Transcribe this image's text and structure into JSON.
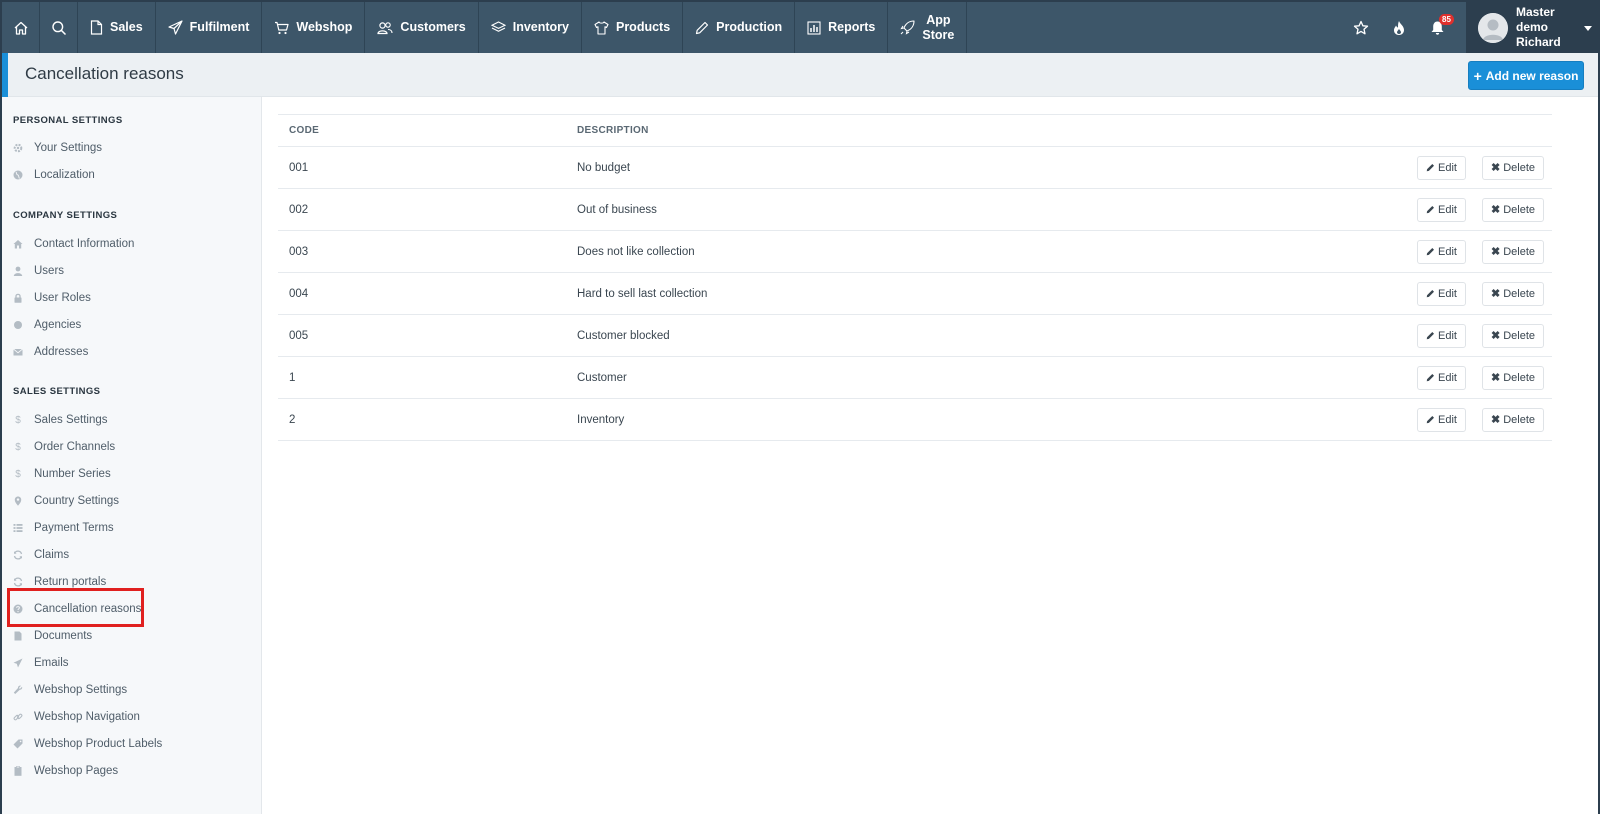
{
  "nav": {
    "items": [
      {
        "label": "Sales",
        "icon": "file-icon"
      },
      {
        "label": "Fulfilment",
        "icon": "paper-plane-icon"
      },
      {
        "label": "Webshop",
        "icon": "cart-icon"
      },
      {
        "label": "Customers",
        "icon": "users-icon"
      },
      {
        "label": "Inventory",
        "icon": "stack-icon"
      },
      {
        "label": "Products",
        "icon": "tshirt-icon"
      },
      {
        "label": "Production",
        "icon": "pencil-icon"
      },
      {
        "label": "Reports",
        "icon": "bar-chart-icon"
      }
    ],
    "app_store": {
      "line1": "App",
      "line2": "Store"
    },
    "notification_count": "85",
    "user": {
      "line1": "Master demo",
      "line2": "Richard"
    }
  },
  "header": {
    "title": "Cancellation reasons",
    "add_button": "Add new reason"
  },
  "sidebar": {
    "personal_heading": "PERSONAL SETTINGS",
    "personal": [
      "Your Settings",
      "Localization"
    ],
    "company_heading": "COMPANY SETTINGS",
    "company": [
      "Contact Information",
      "Users",
      "User Roles",
      "Agencies",
      "Addresses"
    ],
    "sales_heading": "SALES SETTINGS",
    "sales": [
      "Sales Settings",
      "Order Channels",
      "Number Series",
      "Country Settings",
      "Payment Terms",
      "Claims",
      "Return portals",
      "Cancellation reasons",
      "Documents",
      "Emails",
      "Webshop Settings",
      "Webshop Navigation",
      "Webshop Product Labels",
      "Webshop Pages"
    ]
  },
  "table": {
    "headers": {
      "code": "CODE",
      "description": "DESCRIPTION"
    },
    "edit_label": "Edit",
    "delete_label": "Delete",
    "rows": [
      {
        "code": "001",
        "description": "No budget"
      },
      {
        "code": "002",
        "description": "Out of business"
      },
      {
        "code": "003",
        "description": "Does not like collection"
      },
      {
        "code": "004",
        "description": "Hard to sell last collection"
      },
      {
        "code": "005",
        "description": "Customer blocked"
      },
      {
        "code": "1",
        "description": "Customer"
      },
      {
        "code": "2",
        "description": "Inventory"
      }
    ]
  },
  "colors": {
    "nav_bg": "#3d5669",
    "primary": "#1a8fd8",
    "highlight": "#e0201f"
  }
}
